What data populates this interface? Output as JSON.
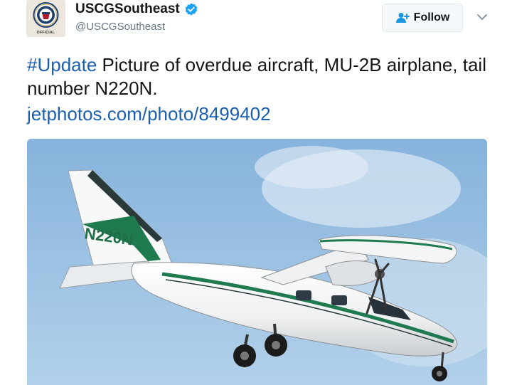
{
  "account": {
    "display_name": "USCGSoutheast",
    "handle": "@USCGSoutheast",
    "verified": true,
    "avatar_icon": "coast-guard-seal-icon",
    "avatar_caption": "OFFICIAL"
  },
  "follow_button": {
    "label": "Follow",
    "icon": "add-user-icon"
  },
  "menu_icon": "chevron-down-icon",
  "tweet": {
    "hashtag": "#Update",
    "text": " Picture of overdue aircraft, MU-2B airplane, tail number N220N.",
    "link": "jetphotos.com/photo/8499402"
  },
  "media": {
    "tail_number": "N220N"
  },
  "colors": {
    "link": "#1b5fb0",
    "verified": "#1da1f2",
    "sky": "#9ec3e4",
    "aircraft_stripe": "#1f7a4f"
  }
}
